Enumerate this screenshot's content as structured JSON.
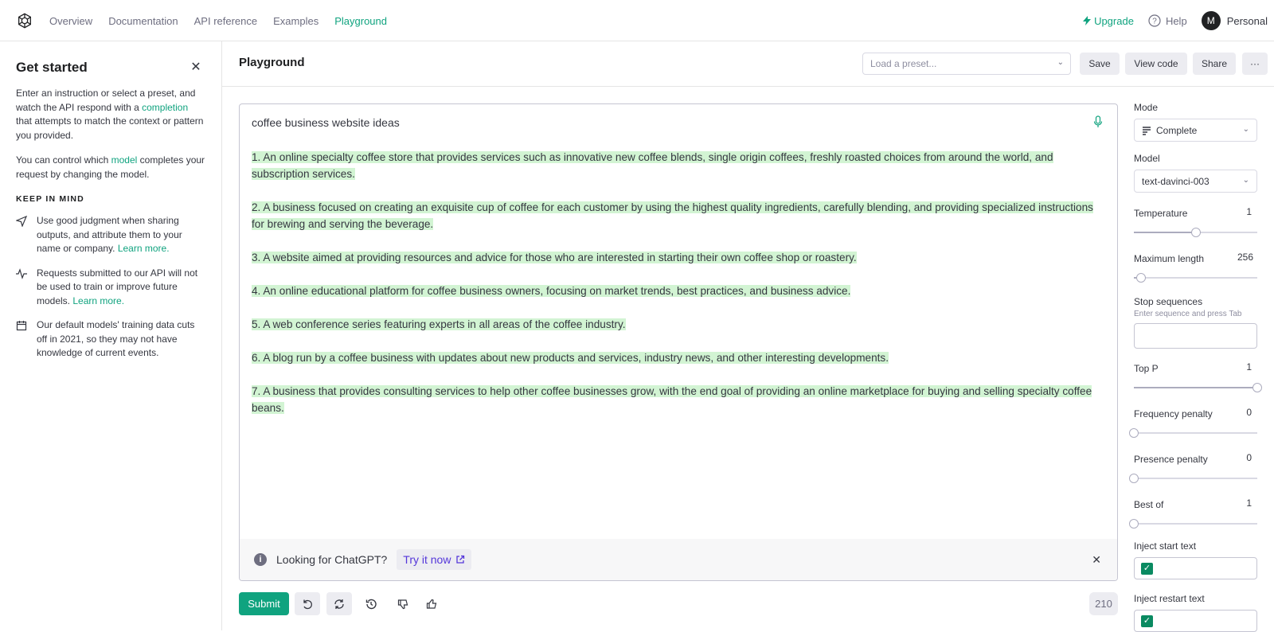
{
  "nav": {
    "links": [
      "Overview",
      "Documentation",
      "API reference",
      "Examples",
      "Playground"
    ],
    "upgrade": "Upgrade",
    "help": "Help",
    "avatar_initial": "M",
    "account": "Personal"
  },
  "sidebar": {
    "title": "Get started",
    "intro_1": "Enter an instruction or select a preset, and watch the API respond with a ",
    "intro_link": "completion",
    "intro_2": " that attempts to match the context or pattern you provided.",
    "model_1": "You can control which ",
    "model_link": "model",
    "model_2": " completes your request by changing the model.",
    "keep_in_mind": "KEEP IN MIND",
    "tips": [
      {
        "icon": "send-icon",
        "text": "Use good judgment when sharing outputs, and attribute them to your name or company. ",
        "link": "Learn more."
      },
      {
        "icon": "pulse-icon",
        "text": "Requests submitted to our API will not be used to train or improve future models. ",
        "link": "Learn more."
      },
      {
        "icon": "calendar-icon",
        "text": "Our default models' training data cuts off in 2021, so they may not have knowledge of current events.",
        "link": ""
      }
    ]
  },
  "header": {
    "title": "Playground",
    "preset_placeholder": "Load a preset...",
    "save": "Save",
    "view_code": "View code",
    "share": "Share",
    "more": "···"
  },
  "editor": {
    "prompt": "coffee business website ideas",
    "completions": [
      "1. An online specialty coffee store that provides services such as innovative new coffee blends, single origin coffees, freshly roasted choices from around the world, and subscription services.",
      "2. A business focused on creating an exquisite cup of coffee for each customer by using the highest quality ingredients, carefully blending, and providing specialized instructions for brewing and serving the beverage.",
      "3. A website aimed at providing resources and advice for those who are interested in starting their own coffee shop or roastery.",
      "4. An online educational platform for coffee business owners, focusing on market trends, best practices, and business advice.",
      "5. A web conference series featuring experts in all areas of the coffee industry.",
      "6. A blog run by a coffee business with updates about new products and services, industry news, and other interesting developments.",
      "7. A business that provides consulting services to help other coffee businesses grow, with the end goal of providing an online marketplace for buying and selling specialty coffee beans."
    ],
    "banner_text": "Looking for ChatGPT?",
    "banner_link": "Try it now"
  },
  "bottom": {
    "submit": "Submit",
    "token_count": "210"
  },
  "settings": {
    "mode_label": "Mode",
    "mode_value": "Complete",
    "model_label": "Model",
    "model_value": "text-davinci-003",
    "temperature": {
      "label": "Temperature",
      "value": "1",
      "fraction": 0.5
    },
    "max_length": {
      "label": "Maximum length",
      "value": "256",
      "fraction": 0.06
    },
    "stop_label": "Stop sequences",
    "stop_hint": "Enter sequence and press Tab",
    "top_p": {
      "label": "Top P",
      "value": "1",
      "fraction": 1.0
    },
    "freq": {
      "label": "Frequency penalty",
      "value": "0",
      "fraction": 0.0
    },
    "presence": {
      "label": "Presence penalty",
      "value": "0",
      "fraction": 0.0
    },
    "best_of": {
      "label": "Best of",
      "value": "1",
      "fraction": 0.0
    },
    "inject_start_label": "Inject start text",
    "inject_restart_label": "Inject restart text"
  },
  "colors": {
    "accent": "#10a37f",
    "highlight": "#d2f4d3",
    "link_purple": "#5436da"
  }
}
